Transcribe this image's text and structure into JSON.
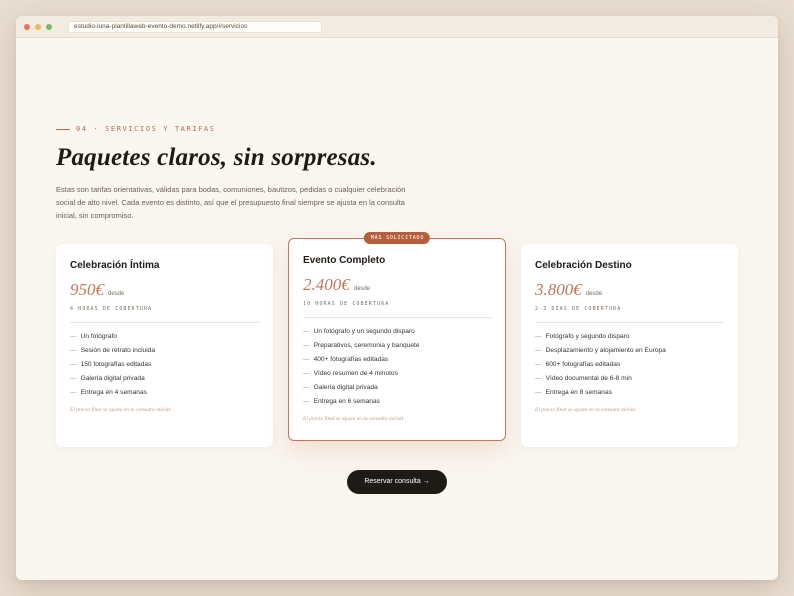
{
  "browser": {
    "url": "estudio-luna-plantillaweb-evento-demo.netlify.app/#servicios"
  },
  "section": {
    "eyebrow": "04 · SERVICIOS Y TARIFAS",
    "title": "Paquetes claros, sin sorpresas.",
    "intro": "Estas son tarifas orientativas, válidas para bodas, comuniones, bautizos, pedidas o cualquier celebración social de alto nivel. Cada evento es distinto, así que el presupuesto final siempre se ajusta en la consulta inicial, sin compromiso."
  },
  "cards": [
    {
      "name": "Celebración Íntima",
      "price": "950€",
      "price_suffix": "desde",
      "coverage": "4 HORAS DE COBERTURA",
      "features": [
        "Un fotógrafo",
        "Sesión de retrato incluida",
        "150 fotografías editadas",
        "Galería digital privada",
        "Entrega en 4 semanas"
      ],
      "note": "El precio final se ajusta en la consulta inicial."
    },
    {
      "badge": "MÁS SOLICITADO",
      "name": "Evento Completo",
      "price": "2.400€",
      "price_suffix": "desde",
      "coverage": "10 HORAS DE COBERTURA",
      "features": [
        "Un fotógrafo y un segundo disparo",
        "Preparativos, ceremonia y banquete",
        "400+ fotografías editadas",
        "Vídeo resumen de 4 minutos",
        "Galería digital privada",
        "Entrega en 6 semanas"
      ],
      "note": "El precio final se ajusta en la consulta inicial."
    },
    {
      "name": "Celebración Destino",
      "price": "3.800€",
      "price_suffix": "desde",
      "coverage": "2-3 DÍAS DE COBERTURA",
      "features": [
        "Fotógrafo y segundo disparo",
        "Desplazamiento y alojamiento en Europa",
        "600+ fotografías editadas",
        "Vídeo documental de 6-8 min",
        "Entrega en 8 semanas"
      ],
      "note": "El precio final se ajusta en la consulta inicial."
    }
  ],
  "cta": {
    "label": "Reservar consulta →"
  },
  "colors": {
    "accent": "#c07858",
    "badge": "#b4603f",
    "dark": "#1f1a16",
    "background": "#faf6f0"
  }
}
